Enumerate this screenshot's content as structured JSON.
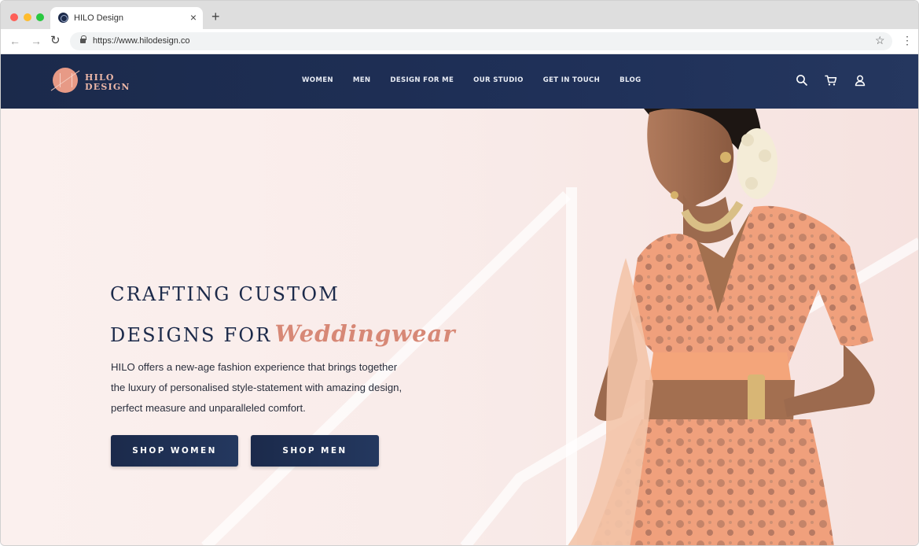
{
  "browser": {
    "tab_title": "HILO Design",
    "tab_close": "×",
    "new_tab": "+",
    "back": "←",
    "forward": "→",
    "reload": "↻",
    "url": "https://www.hilodesign.co",
    "bookmark_icon": "☆",
    "menu_icon": "⋮"
  },
  "header": {
    "logo_line1": "HILO",
    "logo_line2": "DESIGN",
    "nav": [
      "WOMEN",
      "MEN",
      "DESIGN FOR ME",
      "OUR STUDIO",
      "GET IN TOUCH",
      "BLOG"
    ],
    "icons": [
      "search-icon",
      "cart-icon",
      "account-icon"
    ]
  },
  "hero": {
    "headline_line1": "CRAFTING CUSTOM",
    "headline_line2": "DESIGNS FOR",
    "headline_accent": "Weddingwear",
    "body": [
      "HILO offers a new-age fashion experience that brings together",
      "the luxury of personalised style-statement with amazing design,",
      "perfect measure and unparalleled comfort."
    ],
    "cta_women": "SHOP WOMEN",
    "cta_men": "SHOP MEN"
  },
  "colors": {
    "navy": "#1c2a4a",
    "accent": "#d78876",
    "hero_bg": "#f9ecea"
  }
}
